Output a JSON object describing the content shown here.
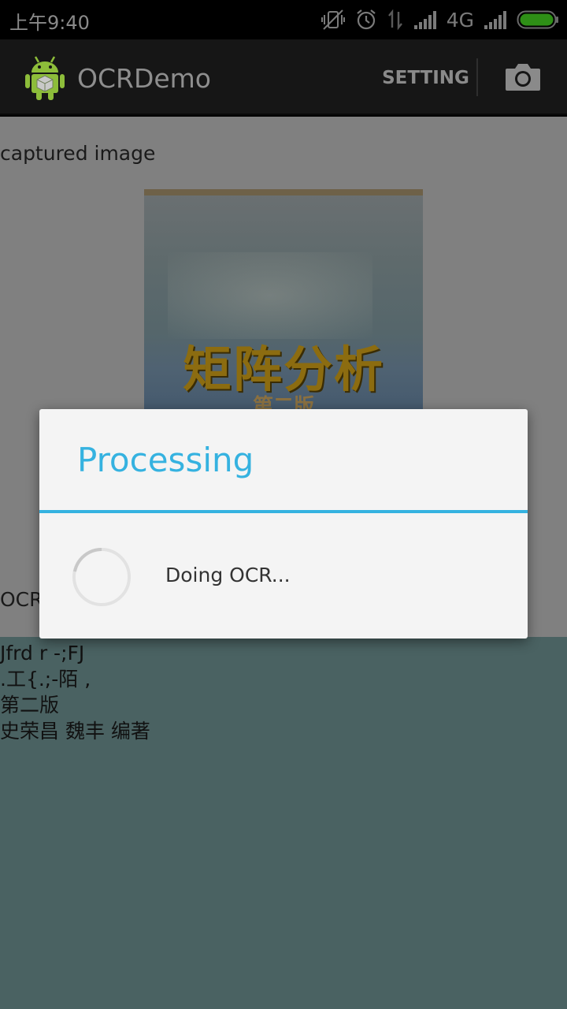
{
  "status_bar": {
    "time": "上午9:40",
    "network_type": "4G"
  },
  "action_bar": {
    "app_title": "OCRDemo",
    "setting_label": "SETTING",
    "app_icon": "android-icon",
    "camera_icon": "camera-icon"
  },
  "content": {
    "captured_label": "captured image",
    "image": {
      "title_text": "矩阵分析",
      "subtitle_text": "第二版"
    },
    "ocr_label": "OCR",
    "ocr_result": "Jfrd r -;FJ\n.工{.;-陌 ,\n第二版\n史荣昌 魏丰 编著"
  },
  "dialog": {
    "title": "Processing",
    "message": "Doing OCR...",
    "accent_color": "#35b2e0"
  }
}
